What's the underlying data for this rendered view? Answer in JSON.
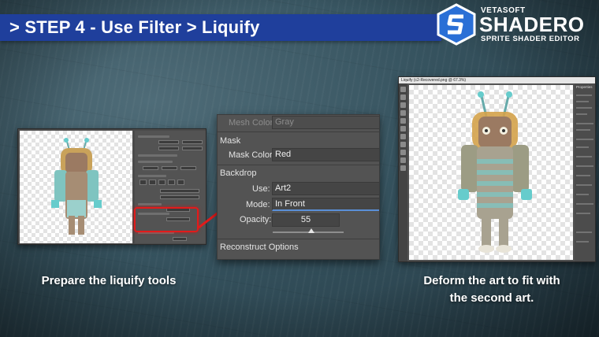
{
  "header": {
    "title": "> STEP 4 - Use Filter > Liquify"
  },
  "logo": {
    "brand_top": "VETASOFT",
    "brand_main": "SHADERO",
    "brand_sub": "SPRITE SHADER EDITOR"
  },
  "zoom_panel": {
    "mesh_color_label": "Mesh Color:",
    "mesh_color_value": "Gray",
    "mask_section": "Mask",
    "mask_color_label": "Mask Color:",
    "mask_color_value": "Red",
    "backdrop_section": "Backdrop",
    "use_label": "Use:",
    "use_value": "Art2",
    "mode_label": "Mode:",
    "mode_value": "In Front",
    "opacity_label": "Opacity:",
    "opacity_value": "55",
    "reconstruct_section": "Reconstruct Options"
  },
  "right_shot": {
    "window_title": "Liquify (c2-Recovered.png @ 67.3%)",
    "properties_title": "Properties"
  },
  "captions": {
    "left": "Prepare the liquify tools",
    "right_line1": "Deform the art to fit with",
    "right_line2": "the second art."
  },
  "colors": {
    "header_bg": "#1f3f9c",
    "highlight": "#e21b1b",
    "mask_color_name": "Red"
  }
}
